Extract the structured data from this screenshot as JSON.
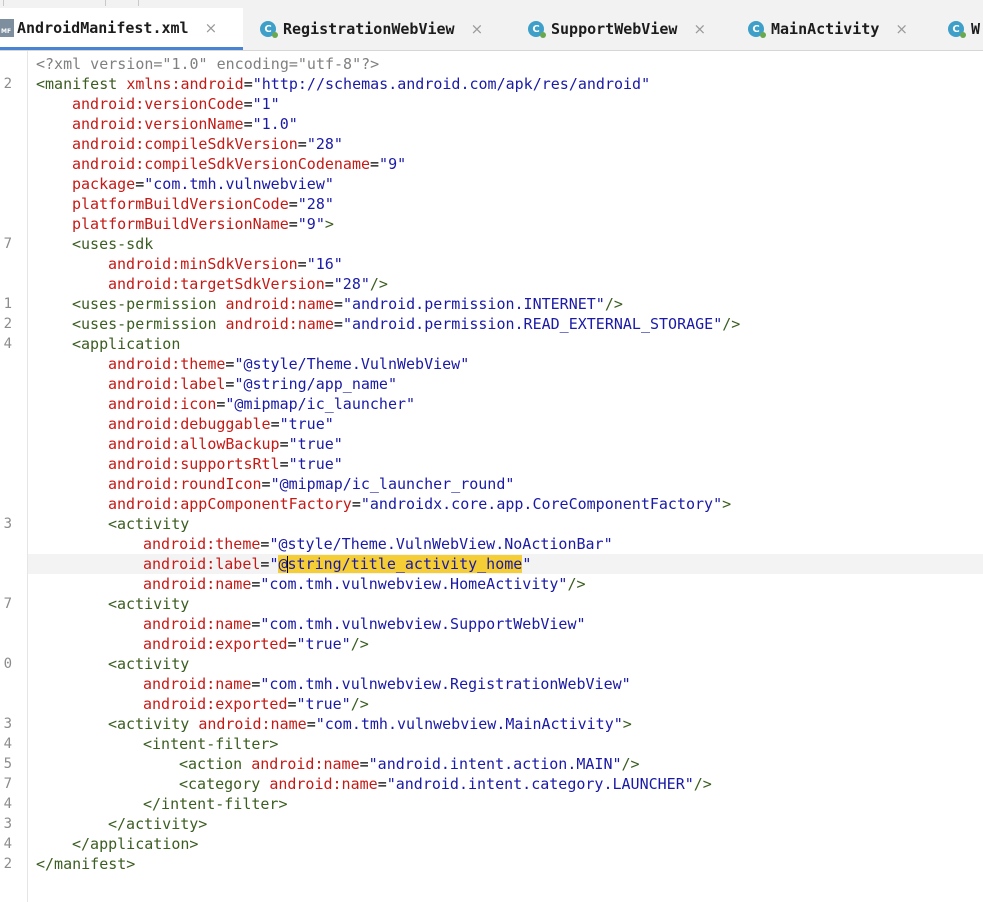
{
  "tabs": [
    {
      "label": "AndroidManifest.xml",
      "kind": "xml",
      "active": true
    },
    {
      "label": "RegistrationWebView",
      "kind": "class",
      "active": false
    },
    {
      "label": "SupportWebView",
      "kind": "class",
      "active": false
    },
    {
      "label": "MainActivity",
      "kind": "class",
      "active": false
    },
    {
      "label": "W",
      "kind": "class",
      "active": false
    }
  ],
  "close_glyph": "×",
  "xml_badge": "MF",
  "class_badge": "C",
  "gutter_numbers": {
    "l2": "2",
    "l7a": "7",
    "l1": "1",
    "l2b": "2",
    "l4": "4",
    "l3": "3",
    "l7b": "7",
    "l0": "0",
    "l3b": "3",
    "l4b": "4",
    "l5": "5",
    "l7c": "7",
    "l4c": "4",
    "l3c": "3",
    "l4d": "4",
    "l2c": "2"
  },
  "code": {
    "xml_decl": "<?xml version=\"1.0\" encoding=\"utf-8\"?>",
    "manifest_open": "<manifest",
    "xmlns_attr": "xmlns:android",
    "xmlns_val": "\"http://schemas.android.com/apk/res/android\"",
    "versionCode_attr": "android:versionCode",
    "versionCode_val": "\"1\"",
    "versionName_attr": "android:versionName",
    "versionName_val": "\"1.0\"",
    "compileSdk_attr": "android:compileSdkVersion",
    "compileSdk_val": "\"28\"",
    "compileSdkCodename_attr": "android:compileSdkVersionCodename",
    "compileSdkCodename_val": "\"9\"",
    "package_attr": "package",
    "package_val": "\"com.tmh.vulnwebview\"",
    "pbvc_attr": "platformBuildVersionCode",
    "pbvc_val": "\"28\"",
    "pbvn_attr": "platformBuildVersionName",
    "pbvn_val": "\"9\"",
    "gt": ">",
    "selfclose": "/>",
    "eq": "=",
    "uses_sdk": "<uses-sdk",
    "minSdk_attr": "android:minSdkVersion",
    "minSdk_val": "\"16\"",
    "targetSdk_attr": "android:targetSdkVersion",
    "targetSdk_val": "\"28\"",
    "uses_permission": "<uses-permission",
    "name_attr": "android:name",
    "perm_internet": "\"android.permission.INTERNET\"",
    "perm_storage": "\"android.permission.READ_EXTERNAL_STORAGE\"",
    "application_open": "<application",
    "theme_attr": "android:theme",
    "app_theme_val": "\"@style/Theme.VulnWebView\"",
    "label_attr": "android:label",
    "app_label_val": "\"@string/app_name\"",
    "icon_attr": "android:icon",
    "icon_val": "\"@mipmap/ic_launcher\"",
    "debuggable_attr": "android:debuggable",
    "true_val": "\"true\"",
    "allowBackup_attr": "android:allowBackup",
    "supportsRtl_attr": "android:supportsRtl",
    "roundIcon_attr": "android:roundIcon",
    "roundIcon_val": "\"@mipmap/ic_launcher_round\"",
    "acf_attr": "android:appComponentFactory",
    "acf_val": "\"androidx.core.app.CoreComponentFactory\"",
    "activity_open": "<activity",
    "home_theme_val": "\"@style/Theme.VulnWebView.NoActionBar\"",
    "home_label_q": "\"",
    "home_label_at": "@",
    "home_label_sel": "string/title_activity_home",
    "home_name_val": "\"com.tmh.vulnwebview.HomeActivity\"",
    "support_name_val": "\"com.tmh.vulnwebview.SupportWebView\"",
    "exported_attr": "android:exported",
    "reg_name_val": "\"com.tmh.vulnwebview.RegistrationWebView\"",
    "main_name_val": "\"com.tmh.vulnwebview.MainActivity\"",
    "intent_filter_open": "<intent-filter>",
    "action_open": "<action",
    "action_main_val": "\"android.intent.action.MAIN\"",
    "category_open": "<category",
    "category_launcher_val": "\"android.intent.category.LAUNCHER\"",
    "intent_filter_close": "</intent-filter>",
    "activity_close": "</activity>",
    "application_close": "</application>",
    "manifest_close": "</manifest>"
  }
}
